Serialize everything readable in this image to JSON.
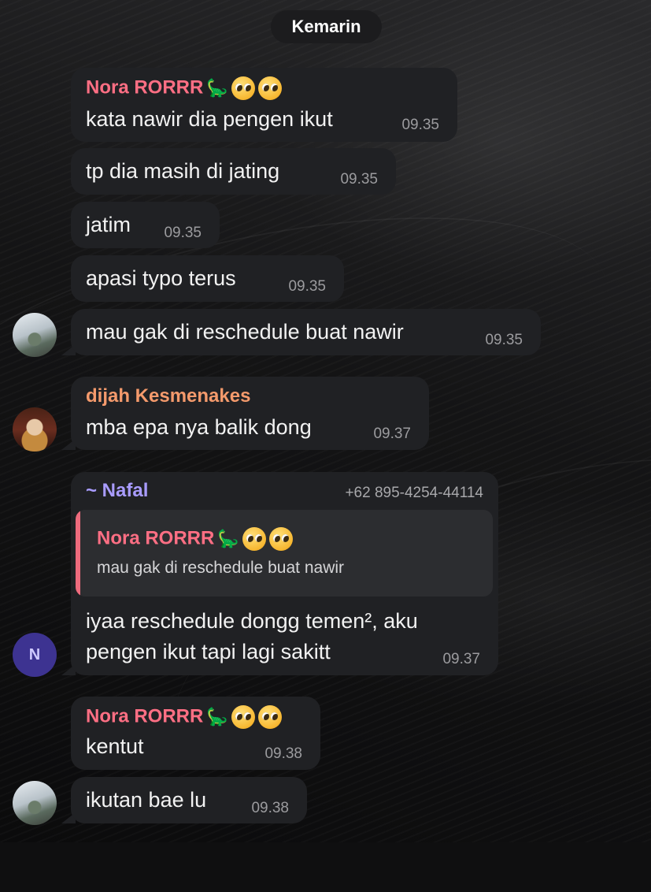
{
  "date_separator": "Kemarin",
  "colors": {
    "nora": "#ff6f84",
    "dijah": "#f49a6c",
    "nafal": "#a99cff",
    "bubble": "#202124",
    "timestamp": "#9c9c9f"
  },
  "messages": [
    {
      "sender": "Nora RORRR",
      "sender_emoji": [
        "dinosaur-icon",
        "pleading-face-icon",
        "pleading-face-icon"
      ],
      "text": "kata nawir dia pengen ikut",
      "time": "09.35"
    },
    {
      "text": "tp dia masih di jating",
      "time": "09.35"
    },
    {
      "text": "jatim",
      "time": "09.35"
    },
    {
      "text": "apasi typo terus",
      "time": "09.35"
    },
    {
      "text": "mau gak di reschedule buat nawir",
      "time": "09.35",
      "avatar": "photo"
    },
    {
      "sender": "dijah Kesmenakes",
      "text": "mba epa nya balik dong",
      "time": "09.37",
      "avatar": "photo"
    },
    {
      "sender": "~ Nafal",
      "phone": "+62 895-4254-44114",
      "quote": {
        "sender": "Nora RORRR",
        "text": "mau gak di reschedule buat nawir"
      },
      "text_lines": [
        "iyaa reschedule dongg temen², aku",
        "pengen ikut tapi lagi sakitt"
      ],
      "time": "09.37",
      "avatar_initial": "N"
    },
    {
      "sender": "Nora RORRR",
      "text": "kentut",
      "time": "09.38"
    },
    {
      "text": "ikutan bae lu",
      "time": "09.38",
      "avatar": "photo"
    }
  ]
}
